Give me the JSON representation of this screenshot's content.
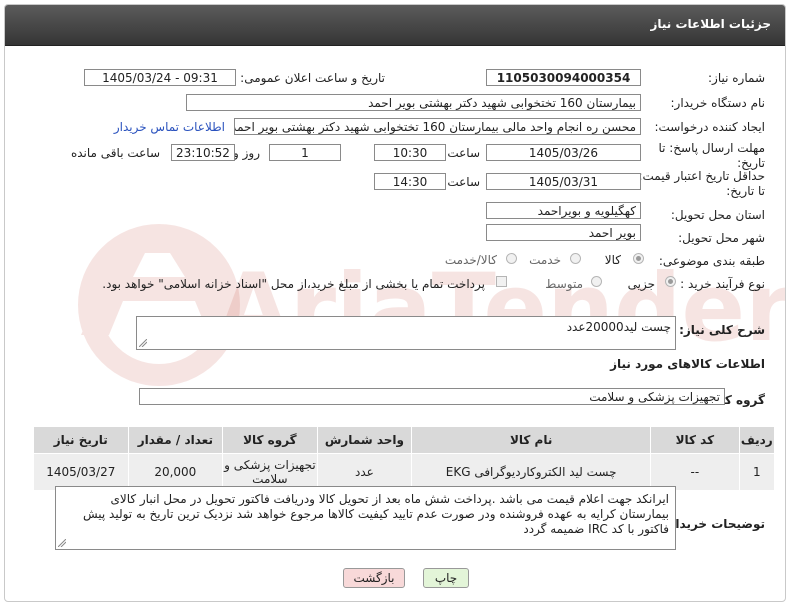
{
  "header": {
    "title": "جزئیات اطلاعات نیاز"
  },
  "fields": {
    "need_number_label": "شماره نیاز:",
    "need_number": "1105030094000354",
    "announce_label": "تاریخ و ساعت اعلان عمومی:",
    "announce_value": "1405/03/24 - 09:31",
    "buyer_org_label": "نام دستگاه خریدار:",
    "buyer_org": "بیمارستان 160 تختخوابی شهید دکتر بهشتی بویر احمد",
    "requester_label": "ایجاد کننده درخواست:",
    "requester": "محسن ره انجام واحد مالی بیمارستان 160 تختخوابی شهید دکتر بهشتی بویر احمد",
    "contact_link": "اطلاعات تماس خریدار",
    "send_deadline_label": "مهلت ارسال پاسخ: تا تاریخ:",
    "send_date": "1405/03/26",
    "time_label": "ساعت",
    "send_time": "10:30",
    "days_value": "1",
    "days_label": "روز و",
    "remaining_time": "23:10:52",
    "remaining_label": "ساعت باقی مانده",
    "validity_label": "حداقل تاریخ اعتبار قیمت: تا تاریخ:",
    "validity_date": "1405/03/31",
    "validity_time": "14:30",
    "province_label": "استان محل تحویل:",
    "province": "کهگیلویه و بویراحمد",
    "city_label": "شهر محل تحویل:",
    "city": "بویر احمد",
    "category_label": "طبقه بندی موضوعی:",
    "category_options": [
      "کالا",
      "خدمت",
      "کالا/خدمت"
    ],
    "process_label": "نوع فرآیند خرید :",
    "process_options": [
      "جزیی",
      "متوسط"
    ],
    "payment_note": "پرداخت تمام یا بخشی از مبلغ خرید،از محل \"اسناد خزانه اسلامی\" خواهد بود.",
    "summary_label": "شرح کلی نیاز:",
    "summary": "چست لید20000عدد",
    "goods_info_title": "اطلاعات کالاهای مورد نیاز",
    "goods_group_label": "گروه کالا:",
    "goods_group": "تجهیزات پزشکی و سلامت",
    "buyer_notes_label": "توضیحات خریدار:",
    "buyer_notes": "ایرانکد جهت اعلام قیمت می باشد .پرداخت شش ماه بعد از تحویل کالا ودریافت فاکتور تحویل در محل انبار کالای بیمارستان کرایه به عهده فروشنده ودر صورت عدم تایید کیفیت کالاها مرجوع خواهد شد نزدیک ترین تاریخ به تولید پیش فاکتور با کد IRC ضمیمه گردد"
  },
  "table": {
    "headers": [
      "ردیف",
      "کد کالا",
      "نام کالا",
      "واحد شمارش",
      "گروه کالا",
      "تعداد / مقدار",
      "تاریخ نیاز"
    ],
    "rows": [
      [
        "1",
        "--",
        "چست لید الکتروکاردیوگرافی EKG",
        "عدد",
        "تجهیزات پزشکی و سلامت",
        "20,000",
        "1405/03/27"
      ]
    ]
  },
  "buttons": {
    "print": "چاپ",
    "back": "بازگشت"
  },
  "watermark": {
    "text": "AriaTender.neT"
  },
  "colors": {
    "header_bg": "#444444",
    "table_header": "#d9d9d9",
    "table_row": "#eeeeee",
    "link": "#2a52be",
    "print_btn": "#e3f5d8",
    "back_btn": "#f8d9d9"
  }
}
